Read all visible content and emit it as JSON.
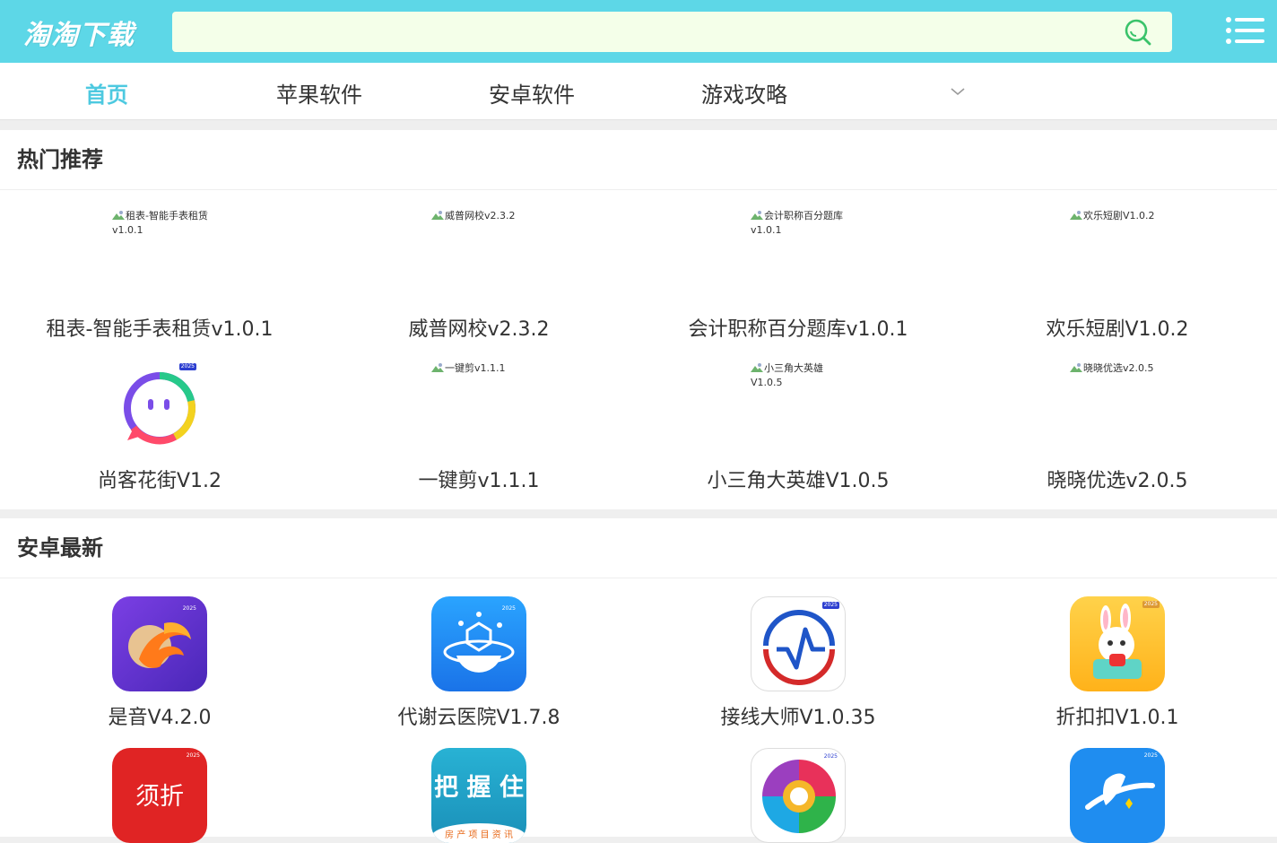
{
  "header": {
    "logo": "淘淘下载",
    "search_placeholder": "",
    "search_value": ""
  },
  "nav": {
    "items": [
      {
        "label": "首页",
        "active": true
      },
      {
        "label": "苹果软件",
        "active": false
      },
      {
        "label": "安卓软件",
        "active": false
      },
      {
        "label": "游戏攻略",
        "active": false
      }
    ]
  },
  "hot": {
    "title": "热门推荐",
    "apps": [
      {
        "name": "租表-智能手表租赁v1.0.1",
        "alt": "租表-智能手表租赁v1.0.1"
      },
      {
        "name": "威普网校v2.3.2",
        "alt": "威普网校v2.3.2"
      },
      {
        "name": "会计职称百分题库v1.0.1",
        "alt": "会计职称百分题库v1.0.1"
      },
      {
        "name": "欢乐短剧V1.0.2",
        "alt": "欢乐短剧V1.0.2"
      },
      {
        "name": "尚客花街V1.2",
        "badge": "2025"
      },
      {
        "name": "一键剪v1.1.1",
        "alt": "一键剪v1.1.1"
      },
      {
        "name": "小三角大英雄V1.0.5",
        "alt": "小三角大英雄V1.0.5"
      },
      {
        "name": "晓晓优选v2.0.5",
        "alt": "晓晓优选v2.0.5"
      }
    ]
  },
  "android": {
    "title": "安卓最新",
    "apps": [
      {
        "name": "是音V4.2.0",
        "badge": "2025"
      },
      {
        "name": "代谢云医院V1.7.8",
        "badge": "2025"
      },
      {
        "name": "接线大师V1.0.35",
        "badge": "2025"
      },
      {
        "name": "折扣扣V1.0.1",
        "badge": "2025"
      },
      {
        "name": "",
        "badge": "2025",
        "icon_text": "须折"
      },
      {
        "name": "",
        "badge": "",
        "icon_text": "把 握 住",
        "icon_subtext": "房 产 项 目 资 讯"
      },
      {
        "name": "",
        "badge": "2025"
      },
      {
        "name": "",
        "badge": "2025"
      }
    ]
  },
  "colors": {
    "header_bg": "#5dd7e7",
    "accent": "#4dc9e0",
    "search_bg": "#f4ffe9"
  }
}
